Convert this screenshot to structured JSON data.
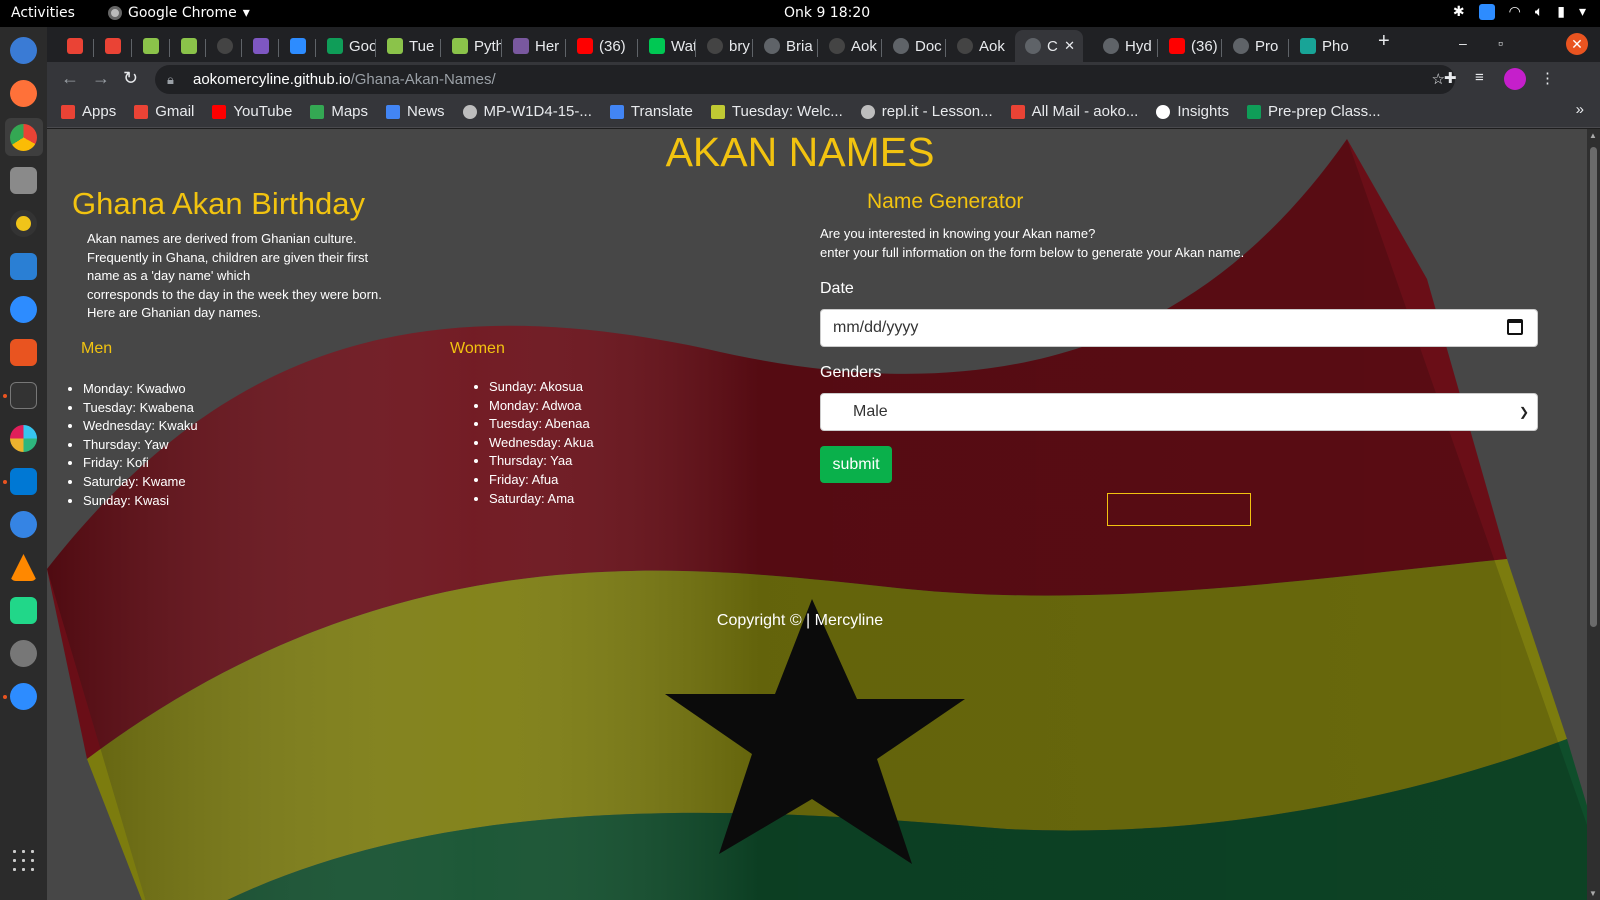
{
  "system": {
    "activities": "Activities",
    "app_name": "Google Chrome",
    "clock": "Onk 9  18:20"
  },
  "tabs": [
    {
      "label": "",
      "icon": "gmail-icon"
    },
    {
      "label": "",
      "icon": "gmail-icon"
    },
    {
      "label": "",
      "icon": "palm-icon"
    },
    {
      "label": "",
      "icon": "palm-icon"
    },
    {
      "label": "",
      "icon": "github-icon"
    },
    {
      "label": "",
      "icon": "cloud-icon"
    },
    {
      "label": "",
      "icon": "zoom-icon"
    },
    {
      "label": "Goo",
      "icon": "sheets-icon"
    },
    {
      "label": "Tue",
      "icon": "palm-icon"
    },
    {
      "label": "Pyth",
      "icon": "palm-icon"
    },
    {
      "label": "Her",
      "icon": "heroku-icon"
    },
    {
      "label": "(36)",
      "icon": "youtube-icon"
    },
    {
      "label": "Wat",
      "icon": "play-icon"
    },
    {
      "label": "bry",
      "icon": "github-icon"
    },
    {
      "label": "Bria",
      "icon": "globe-icon"
    },
    {
      "label": "Aok",
      "icon": "github-icon"
    },
    {
      "label": "Doc",
      "icon": "globe-icon"
    },
    {
      "label": "Aok",
      "icon": "github-icon"
    },
    {
      "label": "C",
      "icon": "globe-icon"
    },
    {
      "label": "Hyd",
      "icon": "globe-icon"
    },
    {
      "label": "(36)",
      "icon": "youtube-icon"
    },
    {
      "label": "Pro",
      "icon": "globe-icon"
    },
    {
      "label": "Pho",
      "icon": "photopea-icon"
    }
  ],
  "address": {
    "host": "aokomercyline.github.io",
    "path": "/Ghana-Akan-Names/"
  },
  "bookmarks": [
    {
      "label": "Apps",
      "icon": "apps-grid-icon",
      "color": "#ea4335"
    },
    {
      "label": "Gmail",
      "icon": "gmail-icon",
      "color": "#ea4335"
    },
    {
      "label": "YouTube",
      "icon": "youtube-icon",
      "color": "#ff0000"
    },
    {
      "label": "Maps",
      "icon": "maps-pin-icon",
      "color": "#34a853"
    },
    {
      "label": "News",
      "icon": "news-icon",
      "color": "#4285f4"
    },
    {
      "label": "MP-W1D4-15-...",
      "icon": "globe-icon",
      "color": "#bdbdbd"
    },
    {
      "label": "Translate",
      "icon": "translate-icon",
      "color": "#4285f4"
    },
    {
      "label": "Tuesday: Welc...",
      "icon": "palm-icon",
      "color": "#c0ca33"
    },
    {
      "label": "repl.it - Lesson...",
      "icon": "replit-icon",
      "color": "#bdbdbd"
    },
    {
      "label": "All Mail - aoko...",
      "icon": "gmail-icon",
      "color": "#ea4335"
    },
    {
      "label": "Insights",
      "icon": "github-icon",
      "color": "#ffffff"
    },
    {
      "label": "Pre-prep Class...",
      "icon": "sheets-icon",
      "color": "#0f9d58"
    }
  ],
  "page": {
    "title": "AKAN NAMES",
    "left_title": "Ghana Akan Birthday",
    "intro_lines": [
      "Akan names are derived from Ghanian culture.",
      "Frequently in Ghana, children are given their first",
      "name as a 'day name' which",
      "corresponds to the day in the week they were born.",
      "Here are Ghanian day names."
    ],
    "men_heading": "Men",
    "men": [
      "Monday: Kwadwo",
      "Tuesday: Kwabena",
      "Wednesday: Kwaku",
      "Thursday: Yaw",
      "Friday: Kofi",
      "Saturday: Kwame",
      "Sunday: Kwasi"
    ],
    "women_heading": "Women",
    "women": [
      "Sunday: Akosua",
      "Monday: Adwoa",
      "Tuesday: Abenaa",
      "Wednesday: Akua",
      "Thursday: Yaa",
      "Friday: Afua",
      "Saturday: Ama"
    ],
    "form": {
      "title": "Name Generator",
      "intro_lines": [
        "Are you interested in knowing your Akan name?",
        "enter your full information on the form below to generate your Akan name."
      ],
      "date_label": "Date",
      "date_placeholder": "mm/dd/yyyy",
      "gender_label": "Genders",
      "gender_selected": "Male",
      "submit": "submit",
      "result": ""
    },
    "copyright": "Copyright © | Mercyline"
  },
  "colors": {
    "accent_yellow": "#f2c310",
    "submit_green": "#0ab04b",
    "flag_red": "#7a0a14",
    "flag_gold": "#8a8a0a",
    "flag_green": "#0a4a2a"
  }
}
